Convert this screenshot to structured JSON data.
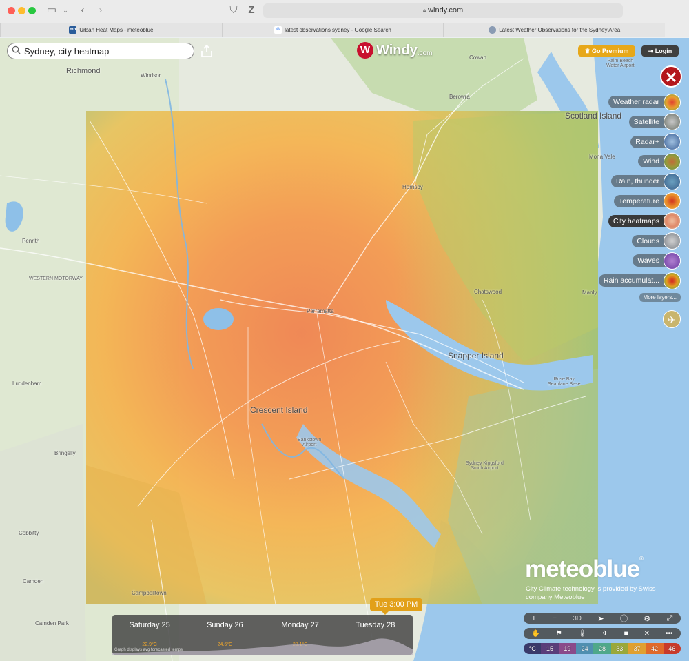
{
  "browser": {
    "url": "windy.com",
    "tabs": [
      {
        "label": "Urban Heat Maps - meteoblue",
        "favicon": "mb"
      },
      {
        "label": "latest observations sydney - Google Search",
        "favicon": "G"
      },
      {
        "label": "Latest Weather Observations for the Sydney Area",
        "favicon": ""
      }
    ]
  },
  "search": {
    "value": "Sydney, city heatmap"
  },
  "logo": {
    "mark": "W",
    "name": "Windy",
    "suffix": ".com"
  },
  "header": {
    "premium_label": "Go Premium",
    "login_label": "Login"
  },
  "layers": [
    {
      "label": "Weather radar",
      "color": "#d98c2a"
    },
    {
      "label": "Satellite",
      "color": "#8a8f86"
    },
    {
      "label": "Radar+",
      "color": "#5a7fb5"
    },
    {
      "label": "Wind",
      "color": "#a0964a"
    },
    {
      "label": "Rain, thunder",
      "color": "#4f7aa8"
    },
    {
      "label": "Temperature",
      "color": "#e8862a"
    },
    {
      "label": "City heatmaps",
      "color": "#e9a07a",
      "active": true
    },
    {
      "label": "Clouds",
      "color": "#9aa0a6"
    },
    {
      "label": "Waves",
      "color": "#7a4fb0"
    },
    {
      "label": "Rain accumulat...",
      "color": "#d0402f"
    }
  ],
  "more_layers_label": "More layers...",
  "places": {
    "richmond": "Richmond",
    "windsor": "Windsor",
    "cowan": "Cowan",
    "palm_beach": "Palm Beach\nWater Airport",
    "berowra": "Berowra",
    "scotland_island": "Scotland Island",
    "mona_vale": "Mona Vale",
    "hornsby": "Hornsby",
    "penrith": "Penrith",
    "western_motorway": "WESTERN MOTORWAY",
    "chatswood": "Chatswood",
    "manly": "Manly",
    "parramatta": "Parramatta",
    "snapper_island": "Snapper Island",
    "rose_bay": "Rose Bay\nSeaplane Base",
    "luddenham": "Luddenham",
    "crescent_island": "Crescent Island",
    "bankstown": "Bankstown\nAirport",
    "bringelly": "Bringelly",
    "sydney_airport": "Sydney Kingsford\nSmith Airport",
    "cobbitty": "Cobbitty",
    "camden": "Camden",
    "campbelltown": "Campbelltown",
    "camden_park": "Camden Park"
  },
  "meteoblue": {
    "logo": "meteoblue",
    "reg": "®",
    "credit": "City Climate technology is provided by Swiss company Meteoblue"
  },
  "timeline": {
    "current_time": "Tue 3:00 PM",
    "note": "Graph displays avg forecasted temps",
    "days": [
      {
        "label": "Saturday 25",
        "temp": "22.9°C"
      },
      {
        "label": "Sunday 26",
        "temp": "24.6°C"
      },
      {
        "label": "Monday 27",
        "temp": "28.1°C"
      },
      {
        "label": "Tuesday 28",
        "temp": ""
      }
    ]
  },
  "controls": {
    "zoom_in": "+",
    "zoom_out": "−",
    "three_d": "3D"
  },
  "legend": {
    "unit": "°C",
    "values": [
      "15",
      "19",
      "24",
      "28",
      "33",
      "37",
      "42",
      "46"
    ],
    "colors": [
      "#3a3a6a",
      "#5a3d7a",
      "#8a4a8a",
      "#4f8fb0",
      "#4fa88a",
      "#9aa83a",
      "#e0a030",
      "#e06a2a",
      "#c83a2a"
    ]
  }
}
